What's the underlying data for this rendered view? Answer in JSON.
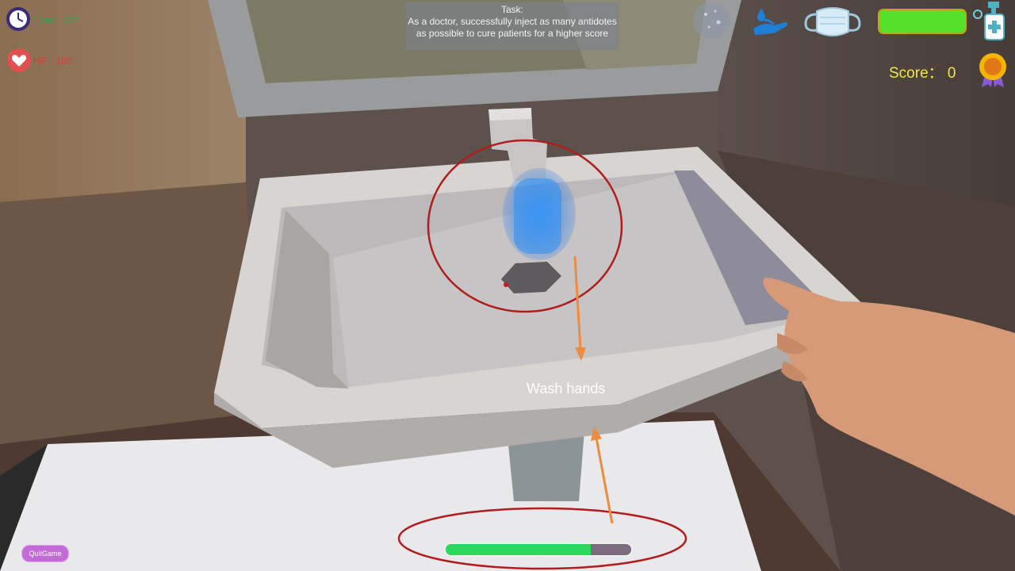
{
  "hud": {
    "timer": "Timer：277",
    "hp": "HP：100",
    "health_bar_fill": 1.0,
    "score": "Score： 0"
  },
  "task": {
    "title": "Task:",
    "text": "As a doctor, successfully inject as many antidotes as possible to cure patients for a higher score"
  },
  "icons": {
    "timer": "clock-icon",
    "hp": "heart-icon",
    "virus": "virus-icon",
    "wash": "hand-wash-icon",
    "mask": "face-mask-icon",
    "sanitizer": "sanitizer-icon",
    "medal": "medal-icon"
  },
  "annotation": {
    "label": "Wash hands",
    "color": "#b01d1d",
    "arrow_color": "#f08a3c"
  },
  "progress": {
    "value": 0.78
  },
  "buttons": {
    "quit": "QuitGame"
  },
  "colors": {
    "water": "#2f8ff0",
    "health": "#57e12c",
    "progress": "#2bd95d",
    "quit_button": "#c36bd6"
  }
}
